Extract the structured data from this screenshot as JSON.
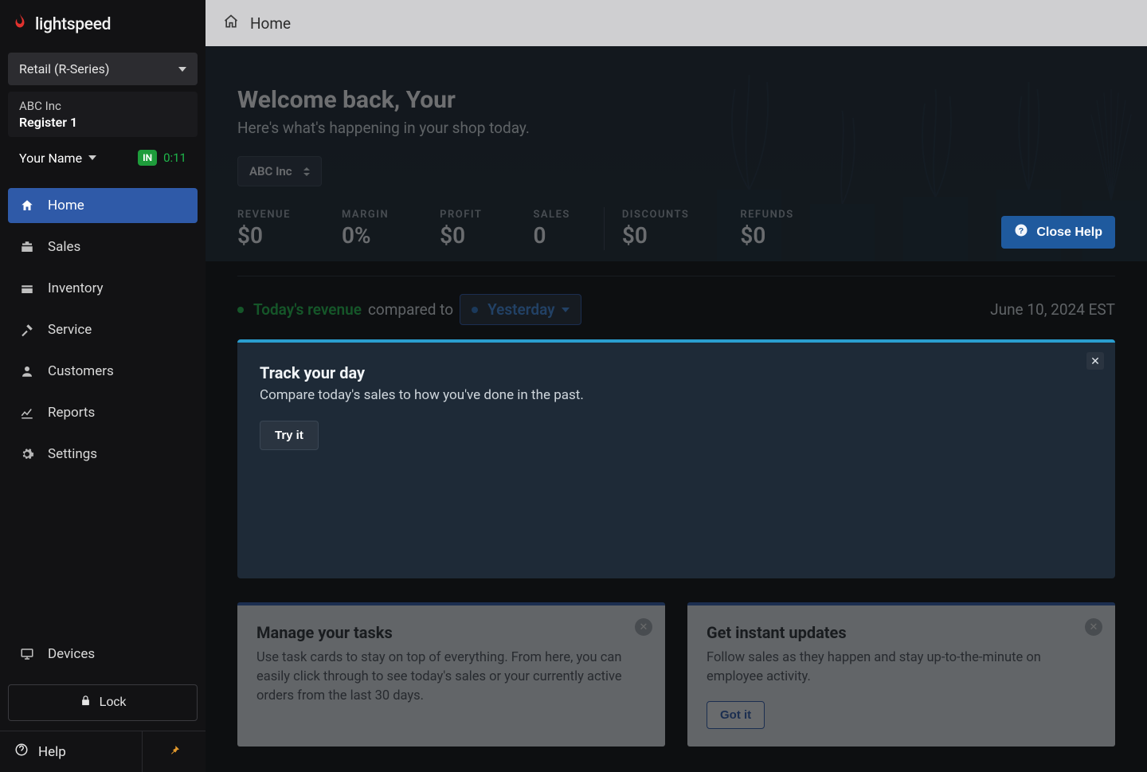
{
  "brand": "lightspeed",
  "productSelector": "Retail (R-Series)",
  "shop": {
    "company": "ABC Inc",
    "register": "Register 1"
  },
  "user": {
    "name": "Your Name",
    "status": "IN",
    "timer": "0:11"
  },
  "nav": {
    "items": [
      {
        "label": "Home",
        "slug": "home"
      },
      {
        "label": "Sales",
        "slug": "sales"
      },
      {
        "label": "Inventory",
        "slug": "inventory"
      },
      {
        "label": "Service",
        "slug": "service"
      },
      {
        "label": "Customers",
        "slug": "customers"
      },
      {
        "label": "Reports",
        "slug": "reports"
      },
      {
        "label": "Settings",
        "slug": "settings"
      }
    ],
    "devices": "Devices",
    "lock": "Lock",
    "help": "Help"
  },
  "topbar": {
    "title": "Home"
  },
  "hero": {
    "welcome": "Welcome back, Your",
    "subtitle": "Here's what's happening in your shop today.",
    "shopPill": "ABC Inc",
    "metrics": [
      {
        "label": "REVENUE",
        "value": "$0"
      },
      {
        "label": "MARGIN",
        "value": "0%"
      },
      {
        "label": "PROFIT",
        "value": "$0"
      },
      {
        "label": "SALES",
        "value": "0"
      },
      {
        "label": "DISCOUNTS",
        "value": "$0"
      },
      {
        "label": "REFUNDS",
        "value": "$0"
      }
    ],
    "closeHelp": "Close Help"
  },
  "compare": {
    "revenueLabel": "Today's revenue",
    "middle": "compared to",
    "target": "Yesterday",
    "date": "June 10, 2024 EST"
  },
  "trackPanel": {
    "title": "Track your day",
    "body": "Compare today's sales to how you've done in the past.",
    "cta": "Try it"
  },
  "cards": [
    {
      "title": "Manage your tasks",
      "body": "Use task cards to stay on top of everything. From here, you can easily click through to see today's sales or your currently active orders from the last 30 days."
    },
    {
      "title": "Get instant updates",
      "body": "Follow sales as they happen and stay up-to-the-minute on employee activity.",
      "cta": "Got it"
    }
  ]
}
